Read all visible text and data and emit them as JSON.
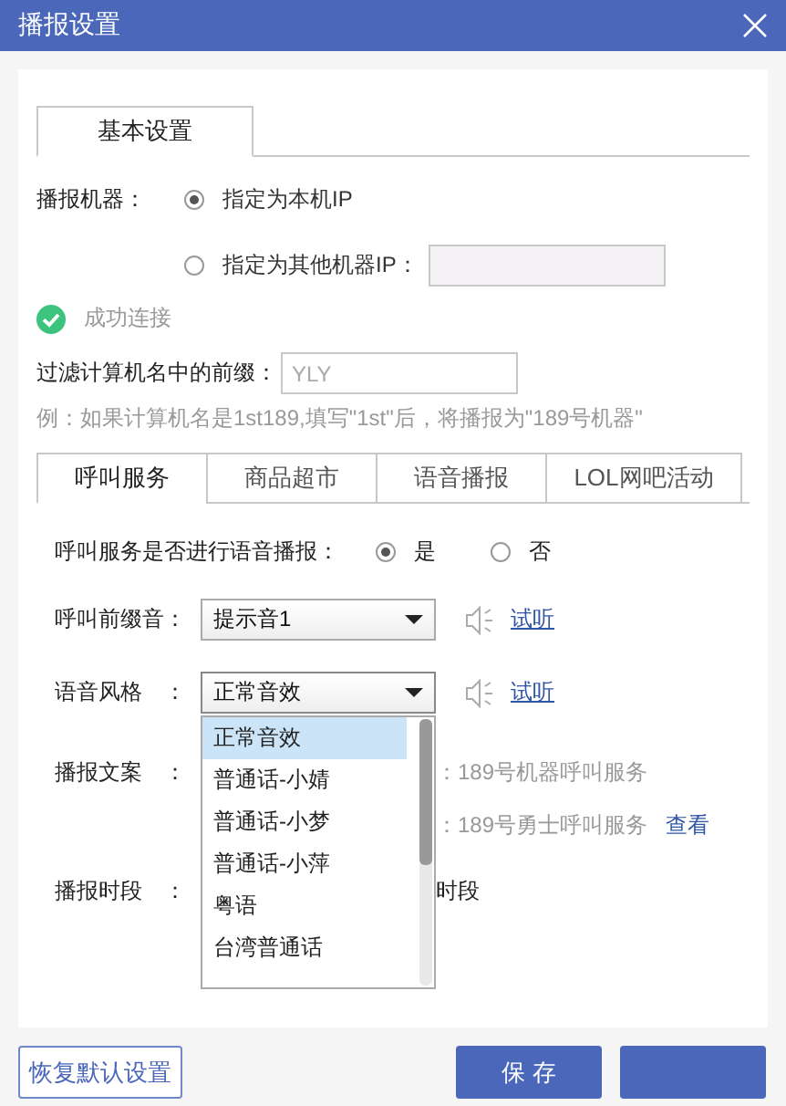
{
  "window": {
    "title": "播报设置"
  },
  "main_tabs": [
    {
      "label": "基本设置",
      "selected": true
    }
  ],
  "machine": {
    "label": "播报机器：",
    "options": [
      {
        "label": "指定为本机IP",
        "selected": true,
        "kind": "plain"
      },
      {
        "label": "指定为其他机器IP：",
        "selected": false,
        "kind": "with-field"
      }
    ]
  },
  "status": {
    "text": "成功连接",
    "connected": true
  },
  "prefix_filter": {
    "label": "过滤计算机名中的前缀：",
    "placeholder": "YLY"
  },
  "example": "例：如果计算机名是1st189,填写\"1st\"后，将播报为\"189号机器\"",
  "sub_tabs": [
    {
      "label": "呼叫服务",
      "selected": true
    },
    {
      "label": "商品超市",
      "selected": false
    },
    {
      "label": "语音播报",
      "selected": false
    },
    {
      "label": "LOL网吧活动",
      "selected": false
    }
  ],
  "voice_question": {
    "label": "呼叫服务是否进行语音播报：",
    "options": [
      {
        "label": "是",
        "selected": true
      },
      {
        "label": "否",
        "selected": false
      }
    ]
  },
  "selects": [
    {
      "label": "呼叫前缀音：",
      "value": "提示音1",
      "listen": "试听",
      "expanded": false
    },
    {
      "label": "语音风格　：",
      "value": "正常音效",
      "listen": "试听",
      "expanded": true,
      "options": [
        {
          "label": "正常音效",
          "selected": true
        },
        {
          "label": "普通话-小婧",
          "selected": false
        },
        {
          "label": "普通话-小梦",
          "selected": false
        },
        {
          "label": "普通话-小萍",
          "selected": false
        },
        {
          "label": "粤语",
          "selected": false
        },
        {
          "label": "台湾普通话",
          "selected": false
        }
      ]
    }
  ],
  "rows": [
    {
      "label": "播报文案　：",
      "partial": "：189号机器呼叫服务"
    },
    {
      "partial": "：189号勇士呼叫服务",
      "link": "查看"
    },
    {
      "label": "播报时段　：",
      "partial": "时段"
    }
  ],
  "footer": {
    "buttons": [
      {
        "label": "恢复默认设置",
        "kind": "outline"
      },
      {
        "label": "保 存",
        "kind": "primary"
      },
      {
        "kind": "primary"
      }
    ]
  }
}
